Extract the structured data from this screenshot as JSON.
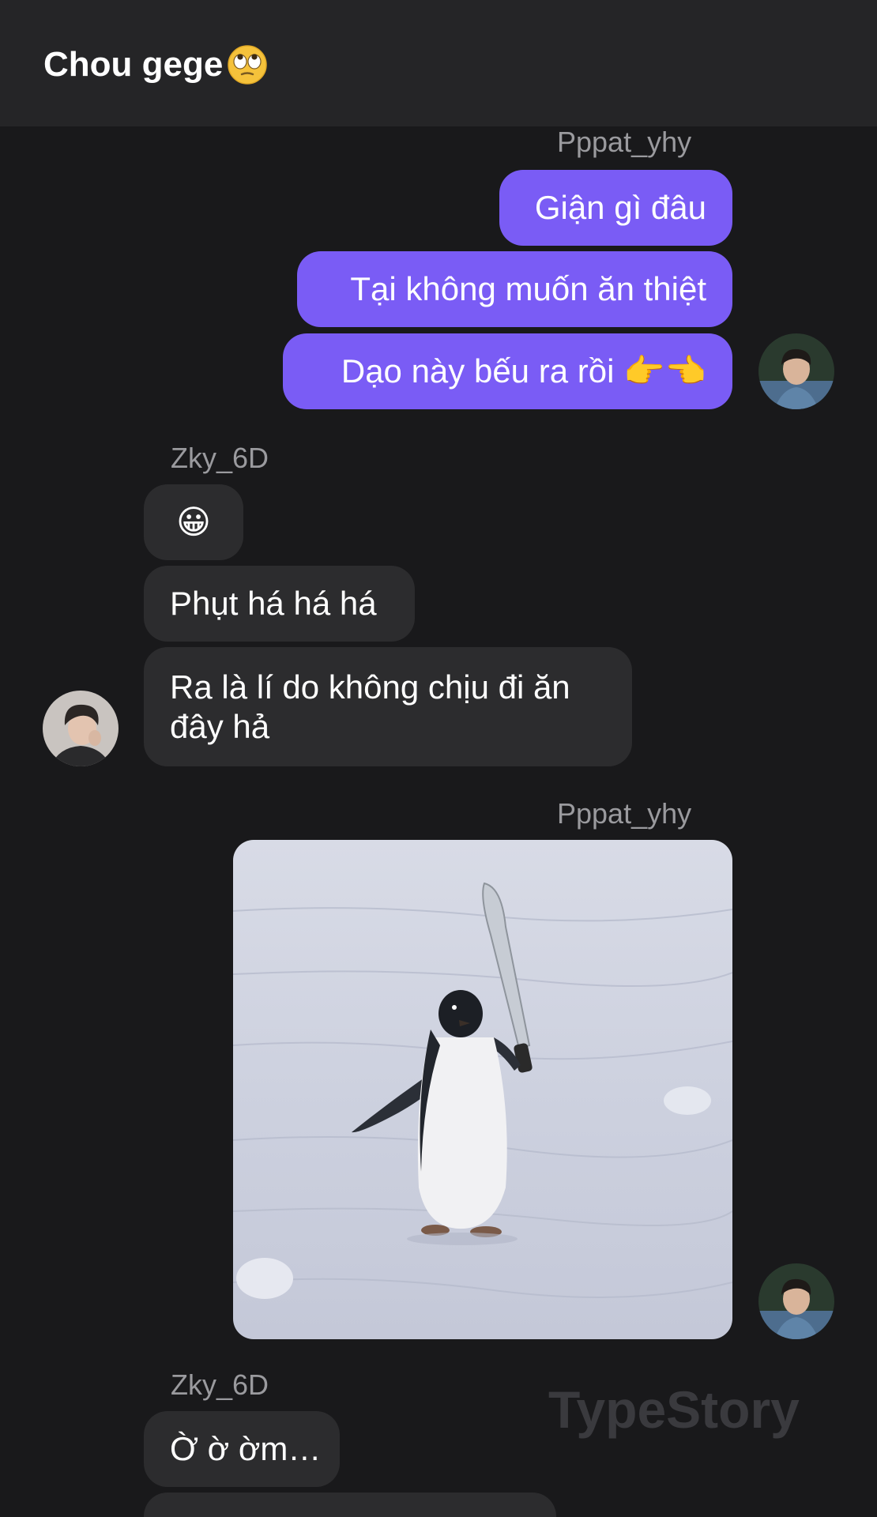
{
  "header": {
    "title": "Chou gege",
    "title_emoji": "face-with-rolling-eyes-icon"
  },
  "messages": {
    "group1": {
      "sender": "Pppat_yhy",
      "bubbles": [
        "Giận gì đâu",
        "Tại không muốn ăn thiệt",
        "Dạo này bếu ra rồi"
      ],
      "emoji_suffix": "👉👈"
    },
    "group2": {
      "sender": "Zky_6D",
      "bubbles": [
        "😀",
        "Phụt há há há",
        "Ra là lí do không chịu đi ăn đây hả"
      ]
    },
    "group3": {
      "sender": "Pppat_yhy",
      "image": "penguin-with-knife-photo"
    },
    "group4": {
      "sender": "Zky_6D",
      "bubbles": [
        "Ờ ờ ờm…"
      ]
    }
  },
  "watermark": "TypeStory",
  "colors": {
    "background": "#19191b",
    "header": "#252527",
    "outgoing_bubble": "#7a5cf5",
    "incoming_bubble": "#2c2c2e",
    "sender_name": "#9a9a9e"
  }
}
